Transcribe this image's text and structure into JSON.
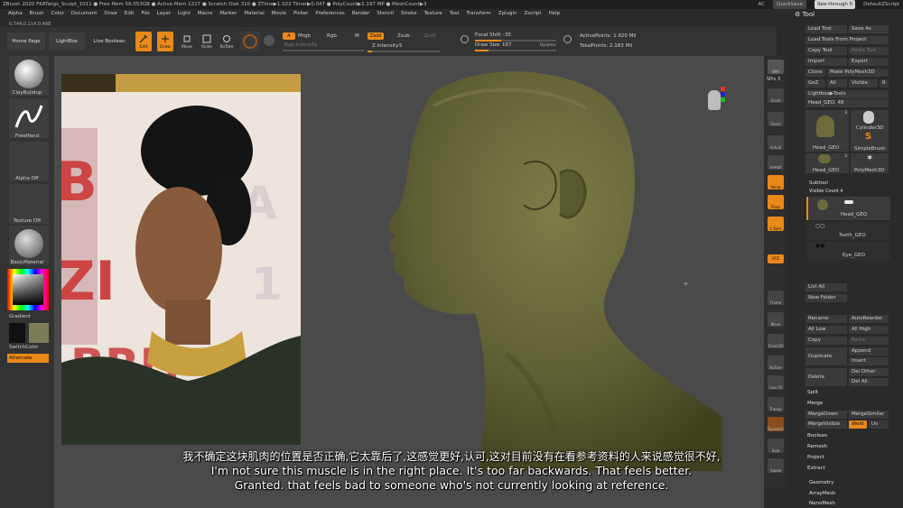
{
  "titlebar": {
    "text": "ZBrush 2020    FKATwigs_Sculpt_1011    ● Free Mem 56.053GB ● Active Mem 1227 ● Scratch Disk 310 ● ZTime▶1.022 Timer▶0.047 ● PolyCount▶2.197 MP ● MeshCount▶3",
    "ac": "AC",
    "quicksave": "QuickSave",
    "seethrough": "See-through  0",
    "defaultzscript": "DefaultZScript"
  },
  "menu": [
    "Alpha",
    "Brush",
    "Color",
    "Document",
    "Draw",
    "Edit",
    "File",
    "Layer",
    "Light",
    "Macro",
    "Marker",
    "Material",
    "Movie",
    "Picker",
    "Preferences",
    "Render",
    "Stencil",
    "Stroke",
    "Texture",
    "Tool",
    "Transform",
    "Zplugin",
    "Zscript",
    "Help"
  ],
  "coords": "0.744,0.114,0.498",
  "toolbar": {
    "home_page": "Home Page",
    "lightbox": "LightBox",
    "live_boolean": "Live Boolean",
    "edit": "Edit",
    "draw": "Draw",
    "move": "Move",
    "scale": "Scale",
    "rotate": "RoTate",
    "a": "A",
    "mrgb": "Mrgb",
    "rgb": "Rgb",
    "m": "M",
    "rgb_intensity": "Rgb Intensity",
    "zadd": "Zadd",
    "zsub": "Zsub",
    "zcut": "Zcut",
    "z_intensity_label": "Z Intensity",
    "z_intensity_value": "5",
    "focal_shift_label": "Focal Shift",
    "focal_shift_value": "-35",
    "draw_size_label": "Draw Size",
    "draw_size_value": "167",
    "dynamic": "Dynamic",
    "active_points": "ActivePoints: 1.920 Mil",
    "total_points": "TotalPoints: 2.183 Mil"
  },
  "leftshelf": {
    "brush1": "ClayBuildup",
    "brush2": "FreeHand",
    "alpha": "Alpha Off",
    "texture": "Texture Off",
    "material": "BasicMaterial",
    "gradient": "Gradient",
    "switch_color": "SwitchColor",
    "alternate": "Alternate"
  },
  "midcol": {
    "bpr": "BPR",
    "spix": "SPix 3",
    "scroll": "Scroll",
    "zoom": "Zoom",
    "actual": "Actual",
    "aahalf": "AAHalf",
    "persp": "Persp",
    "floor": "Floor",
    "lsym": "L.Sym",
    "xyz": "XYZ",
    "frame": "Frame",
    "move": "Move",
    "zoom3d": "Zoom3D",
    "rotate": "RoTate",
    "linefill": "Line Fill",
    "polyf": "PolyF",
    "transp": "Transp",
    "dynamic": "Dynamic",
    "solo": "Solo",
    "xpose": "Xpose"
  },
  "rpanel": {
    "title": "Tool",
    "load_tool": "Load Tool",
    "save_as": "Save As",
    "load_from_project": "Load Tools From Project",
    "copy_tool": "Copy Tool",
    "paste_tool": "Paste Tool",
    "import": "Import",
    "export": "Export",
    "clone": "Clone",
    "make_polymesh": "Make PolyMesh3D",
    "goz": "GoZ",
    "all": "All",
    "visible": "Visible",
    "r": "R",
    "lightbox_tools": "Lightbox▶Tools",
    "head_geo_label": "Head_GEO. 48",
    "thumb1": "Head_GEO",
    "thumb1_count": "3",
    "thumb2": "Cylinder3D",
    "thumb3": "SimpleBrush",
    "thumb4": "Head_GEO",
    "thumb4_count": "3",
    "thumb5": "PolyMesh3D",
    "subtool": "Subtool",
    "visible_count": "Visible Count 4",
    "st1": "Head_GEO",
    "st2": "Teeth_GEO",
    "st3": "Eye_GEO",
    "list_all": "List All",
    "new_folder": "New Folder",
    "rename": "Rename",
    "auto_reorder": "AutoReorder",
    "all_low": "All Low",
    "all_high": "All High",
    "copy": "Copy",
    "paste": "Paste",
    "duplicate": "Duplicate",
    "append": "Append",
    "insert": "Insert",
    "delete": "Delete",
    "del_other": "Del Other",
    "del_all": "Del All",
    "split": "Split",
    "merge": "Merge",
    "merge_down": "MergeDown",
    "merge_similar": "MergeSimilar",
    "merge_visible": "MergeVisible",
    "weld": "Weld",
    "uv": "Uv",
    "boolean": "Boolean",
    "remesh": "Remesh",
    "project": "Project",
    "extract": "Extract",
    "geometry": "Geometry",
    "arraymesh": "ArrayMesh",
    "nanomesh": "NanoMesh"
  },
  "subtitles": {
    "zh": "我不确定这块肌肉的位置是否正确,它太靠后了,这感觉更好,认可,这对目前没有在看参考资料的人来说感觉很不好,",
    "en1": "I'm not sure this muscle is in the right place. It's too far backwards. That feels better.",
    "en2": "Granted. that feels bad to someone who's not currently looking at reference."
  },
  "colors": {
    "accent": "#e8891a",
    "sculpt": "#6b6b3c",
    "bg": "#4a4a4a"
  }
}
